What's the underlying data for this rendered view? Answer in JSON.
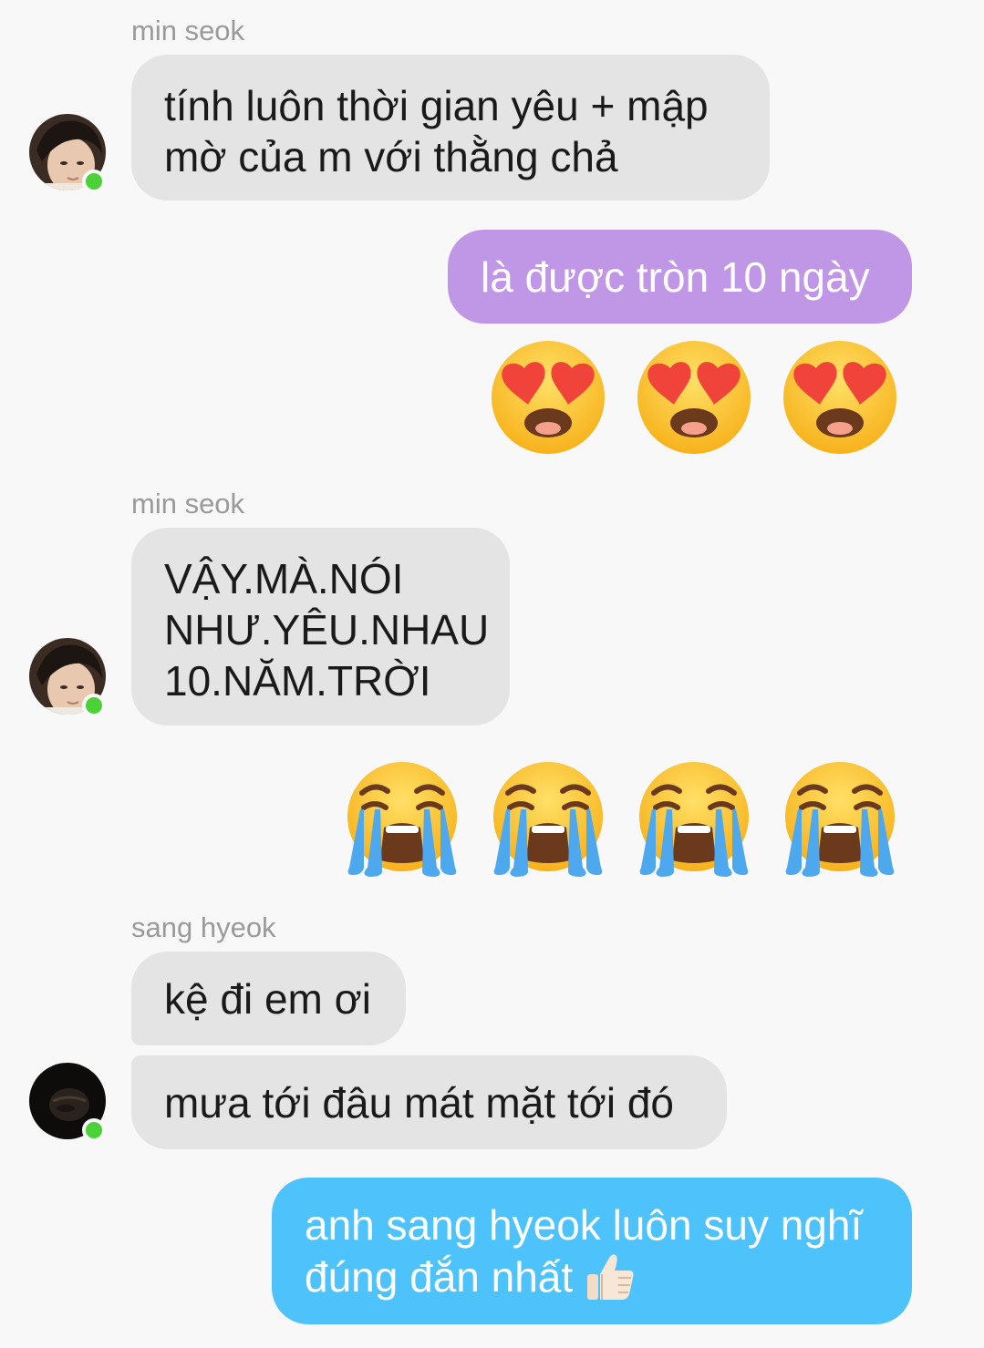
{
  "colors": {
    "background": "#f8f8f8",
    "incoming_bubble": "#e4e4e4",
    "outgoing_purple": "#c096e6",
    "outgoing_blue": "#4ec3fb",
    "online_status": "#4cd137",
    "sender_name": "#9a9a9a"
  },
  "messages": [
    {
      "sender": "min seok",
      "lines": [
        "tính luôn thời gian yêu + mập",
        "mờ của m với thằng chả"
      ],
      "avatar": "avatar-min-seok",
      "online": true
    },
    {
      "outgoing_text": "là được tròn 10 ngày"
    },
    {
      "emoji_reaction": "heart-eyes-emoji",
      "count": 3
    },
    {
      "sender": "min seok",
      "lines": [
        "VẬY.MÀ.NÓI",
        "NHƯ.YÊU.NHAU",
        "10.NĂM.TRỜI"
      ],
      "avatar": "avatar-min-seok",
      "online": true
    },
    {
      "emoji_reaction": "loudly-crying-emoji",
      "count": 4
    },
    {
      "sender": "sang hyeok",
      "lines_a": [
        "kệ đi em ơi"
      ],
      "lines_b": [
        "mưa tới đâu mát mặt tới đó"
      ],
      "avatar": "avatar-sang-hyeok",
      "online": true
    },
    {
      "outgoing_lines": [
        "anh sang hyeok luôn suy nghĩ",
        "đúng đắn nhất"
      ],
      "trailing_icon": "thumbs-up-icon"
    }
  ]
}
